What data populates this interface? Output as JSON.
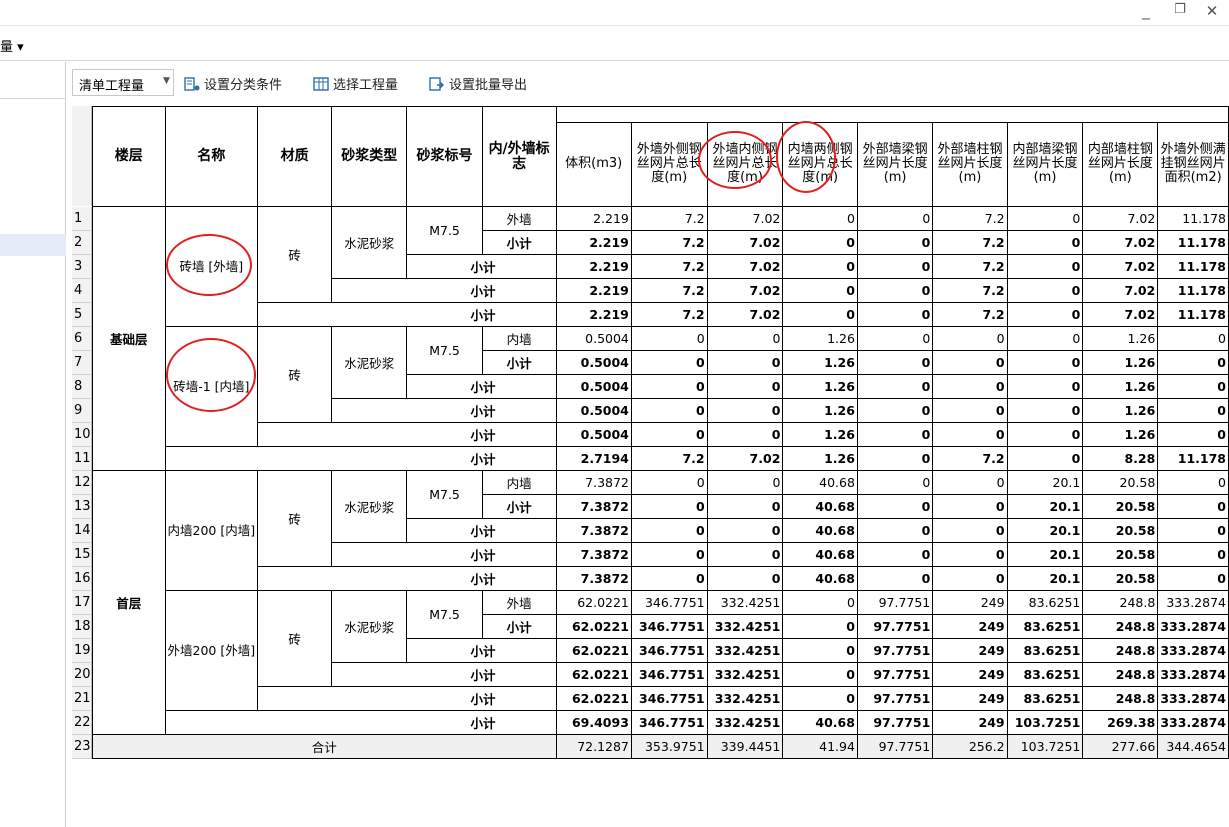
{
  "window": {
    "min_glyph": "_",
    "restore_glyph": "❐",
    "close_glyph": "✕"
  },
  "menubar": {
    "partial_label": "量 ▾"
  },
  "toolbar": {
    "combo_label": "清单工程量",
    "set_classify": "设置分类条件",
    "select_qty": "选择工程量",
    "batch_export": "设置批量导出"
  },
  "headers": {
    "floor": "楼层",
    "name": "名称",
    "material": "材质",
    "mortar_type": "砂浆类型",
    "mortar_grade": "砂浆标号",
    "wall_flag": "内/外墙标志",
    "volume": "体积(m3)",
    "c1": "外墙外侧钢丝网片总长度(m)",
    "c2": "外墙内侧钢丝网片总长度(m)",
    "c3": "内墙两侧钢丝网片总长度(m)",
    "c4": "外部墙梁钢丝网片长度(m)",
    "c5": "外部墙柱钢丝网片长度(m)",
    "c6": "内部墙梁钢丝网片长度(m)",
    "c7": "内部墙柱钢丝网片长度(m)",
    "c8": "外墙外侧满挂钢丝网片面积(m2)"
  },
  "labels": {
    "floor1": "基础层",
    "floor2": "首层",
    "name1": "砖墙 [外墙]",
    "name2": "砖墙-1 [内墙]",
    "name3": "内墙200 [内墙]",
    "name4": "外墙200 [外墙]",
    "material": "砖",
    "mortar": "水泥砂浆",
    "grade": "M7.5",
    "outer": "外墙",
    "inner": "内墙",
    "subtotal": "小计",
    "total": "合计"
  },
  "row_numbers": [
    "1",
    "2",
    "3",
    "4",
    "5",
    "6",
    "7",
    "8",
    "9",
    "10",
    "11",
    "12",
    "13",
    "14",
    "15",
    "16",
    "17",
    "18",
    "19",
    "20",
    "21",
    "22",
    "23"
  ],
  "rows": [
    [
      "2.219",
      "7.2",
      "7.02",
      "0",
      "0",
      "7.2",
      "0",
      "7.02",
      "11.178"
    ],
    [
      "2.219",
      "7.2",
      "7.02",
      "0",
      "0",
      "7.2",
      "0",
      "7.02",
      "11.178"
    ],
    [
      "2.219",
      "7.2",
      "7.02",
      "0",
      "0",
      "7.2",
      "0",
      "7.02",
      "11.178"
    ],
    [
      "2.219",
      "7.2",
      "7.02",
      "0",
      "0",
      "7.2",
      "0",
      "7.02",
      "11.178"
    ],
    [
      "2.219",
      "7.2",
      "7.02",
      "0",
      "0",
      "7.2",
      "0",
      "7.02",
      "11.178"
    ],
    [
      "0.5004",
      "0",
      "0",
      "1.26",
      "0",
      "0",
      "0",
      "1.26",
      "0"
    ],
    [
      "0.5004",
      "0",
      "0",
      "1.26",
      "0",
      "0",
      "0",
      "1.26",
      "0"
    ],
    [
      "0.5004",
      "0",
      "0",
      "1.26",
      "0",
      "0",
      "0",
      "1.26",
      "0"
    ],
    [
      "0.5004",
      "0",
      "0",
      "1.26",
      "0",
      "0",
      "0",
      "1.26",
      "0"
    ],
    [
      "0.5004",
      "0",
      "0",
      "1.26",
      "0",
      "0",
      "0",
      "1.26",
      "0"
    ],
    [
      "2.7194",
      "7.2",
      "7.02",
      "1.26",
      "0",
      "7.2",
      "0",
      "8.28",
      "11.178"
    ],
    [
      "7.3872",
      "0",
      "0",
      "40.68",
      "0",
      "0",
      "20.1",
      "20.58",
      "0"
    ],
    [
      "7.3872",
      "0",
      "0",
      "40.68",
      "0",
      "0",
      "20.1",
      "20.58",
      "0"
    ],
    [
      "7.3872",
      "0",
      "0",
      "40.68",
      "0",
      "0",
      "20.1",
      "20.58",
      "0"
    ],
    [
      "7.3872",
      "0",
      "0",
      "40.68",
      "0",
      "0",
      "20.1",
      "20.58",
      "0"
    ],
    [
      "7.3872",
      "0",
      "0",
      "40.68",
      "0",
      "0",
      "20.1",
      "20.58",
      "0"
    ],
    [
      "62.0221",
      "346.7751",
      "332.4251",
      "0",
      "97.7751",
      "249",
      "83.6251",
      "248.8",
      "333.2874"
    ],
    [
      "62.0221",
      "346.7751",
      "332.4251",
      "0",
      "97.7751",
      "249",
      "83.6251",
      "248.8",
      "333.2874"
    ],
    [
      "62.0221",
      "346.7751",
      "332.4251",
      "0",
      "97.7751",
      "249",
      "83.6251",
      "248.8",
      "333.2874"
    ],
    [
      "62.0221",
      "346.7751",
      "332.4251",
      "0",
      "97.7751",
      "249",
      "83.6251",
      "248.8",
      "333.2874"
    ],
    [
      "62.0221",
      "346.7751",
      "332.4251",
      "0",
      "97.7751",
      "249",
      "83.6251",
      "248.8",
      "333.2874"
    ],
    [
      "69.4093",
      "346.7751",
      "332.4251",
      "40.68",
      "97.7751",
      "249",
      "103.7251",
      "269.38",
      "333.2874"
    ],
    [
      "72.1287",
      "353.9751",
      "339.4451",
      "41.94",
      "97.7751",
      "256.2",
      "103.7251",
      "277.66",
      "344.4654"
    ]
  ],
  "bold_rows": [
    false,
    true,
    true,
    true,
    true,
    false,
    true,
    true,
    true,
    true,
    true,
    false,
    true,
    true,
    true,
    true,
    false,
    true,
    true,
    true,
    true,
    true,
    false
  ],
  "annotation_color": "#e02020"
}
